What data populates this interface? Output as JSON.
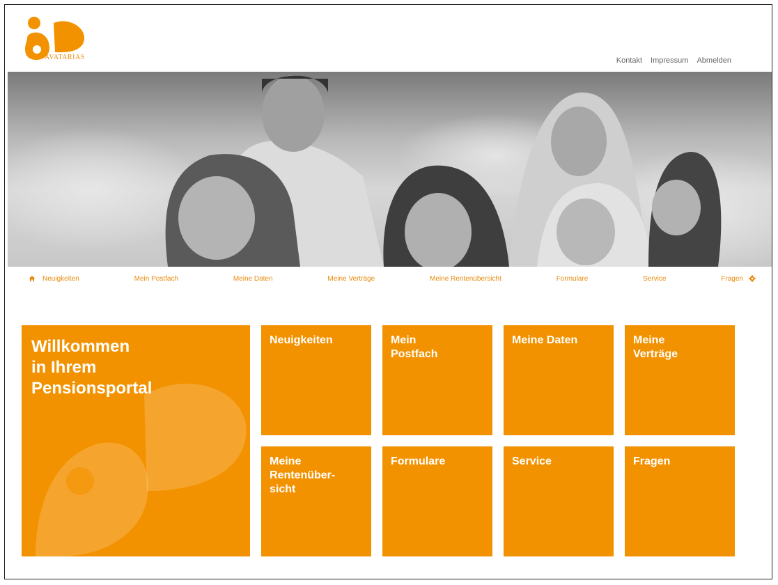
{
  "brand": {
    "logo_text": "AVATARIAS",
    "accent": "#f39200"
  },
  "topnav": {
    "items": [
      "Kontakt",
      "Impressum",
      "Abmelden"
    ]
  },
  "mainnav": {
    "items": [
      "Neuigkeiten",
      "Mein Postfach",
      "Meine Daten",
      "Meine Verträge",
      "Meine Rentenübersicht",
      "Formulare",
      "Service",
      "Fragen"
    ],
    "home_icon": "home-icon",
    "settings_icon": "gear-icon"
  },
  "welcome": {
    "title": "Willkommen\nin Ihrem\nPensionsportal"
  },
  "tiles": [
    {
      "label": "Neuigkeiten"
    },
    {
      "label": "Mein\nPostfach"
    },
    {
      "label": "Meine Daten"
    },
    {
      "label": "Meine\nVerträge"
    },
    {
      "label": "Meine\nRentenüber-\nsicht"
    },
    {
      "label": "Formulare"
    },
    {
      "label": "Service"
    },
    {
      "label": "Fragen"
    }
  ]
}
